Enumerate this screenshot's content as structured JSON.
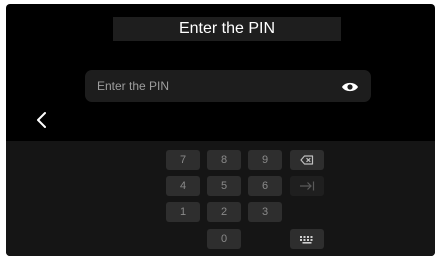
{
  "title": "Enter the PIN",
  "pin_field": {
    "placeholder": "Enter the PIN",
    "visibility_icon": "eye-icon"
  },
  "navigation": {
    "back_icon": "chevron-left-icon"
  },
  "keypad": {
    "rows": [
      [
        "7",
        "8",
        "9"
      ],
      [
        "4",
        "5",
        "6"
      ],
      [
        "1",
        "2",
        "3"
      ],
      [
        "0"
      ]
    ],
    "side_keys": {
      "backspace_icon": "backspace-icon",
      "tab_icon": "tab-icon",
      "keyboard_icon": "keyboard-icon"
    }
  },
  "colors": {
    "background": "#000000",
    "title_bar": "#1e1e1e",
    "field": "#1d1d1d",
    "keypad": "#151515",
    "key": "#2e2e2e",
    "key_text": "#8a8a8a"
  }
}
